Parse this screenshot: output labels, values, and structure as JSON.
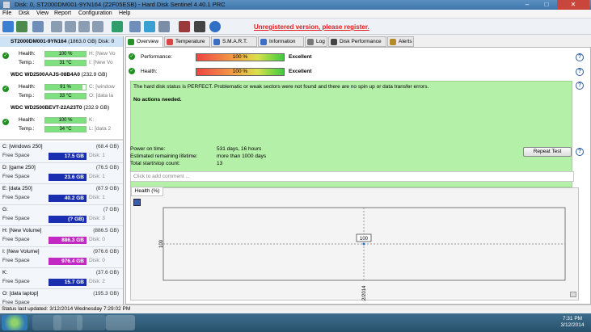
{
  "window": {
    "title": "Disk: 0, ST2000DM001-9YN164 (Z2F05ESB) - Hard Disk Sentinel 4.40.1 PRO",
    "min": "–",
    "max": "□",
    "close": "✕"
  },
  "menu": [
    "File",
    "Disk",
    "View",
    "Report",
    "Configuration",
    "Help"
  ],
  "unregistered": "Unregistered version, please register.",
  "tabs": [
    {
      "label": "Overview",
      "icon": "check-icon",
      "color": "#2a8f2a"
    },
    {
      "label": "Temperature",
      "icon": "thermometer-icon",
      "color": "#d44"
    },
    {
      "label": "S.M.A.R.T.",
      "icon": "smart-icon",
      "color": "#3a6fc4"
    },
    {
      "label": "Information",
      "icon": "info-icon",
      "color": "#3a6fc4"
    },
    {
      "label": "Log",
      "icon": "log-icon",
      "color": "#777"
    },
    {
      "label": "Disk Performance",
      "icon": "performance-icon",
      "color": "#444"
    },
    {
      "label": "Alerts",
      "icon": "alert-icon",
      "color": "#b58a2a"
    }
  ],
  "disks": [
    {
      "name": "ST2000DM001-9YN164",
      "cap": "(1863.0 GB)",
      "disk": "Disk: 0",
      "health": "100 %",
      "health_pct": 100,
      "health_extra": "H: [New Vo",
      "temp": "31 °C",
      "temp_pct": 31,
      "temp_extra": "I: [New Vo",
      "selected": true
    },
    {
      "name": "WDC WD2500AAJS-08B4A0",
      "cap": "(232.9 GB)",
      "disk": "",
      "health": "91 %",
      "health_pct": 91,
      "health_extra": "C: [window",
      "temp": "33 °C",
      "temp_pct": 33,
      "temp_extra": "O: [data la",
      "selected": false
    },
    {
      "name": "WDC WD2500BEVT-22A23T0",
      "cap": "(232.9 GB)",
      "disk": "",
      "health": "100 %",
      "health_pct": 100,
      "health_extra": "K:",
      "temp": "34 °C",
      "temp_pct": 34,
      "temp_extra": "L: [data 2",
      "selected": false
    }
  ],
  "labels": {
    "health": "Health:",
    "temp": "Temp.:",
    "free_space": "Free Space"
  },
  "volumes": [
    {
      "name": "C: [windows 250]",
      "cap": "(68.4 GB)",
      "free": "17.5 GB",
      "color": "#1a2fb0",
      "disk": "Disk: 1"
    },
    {
      "name": "D: [game 250]",
      "cap": "(76.5 GB)",
      "free": "23.6 GB",
      "color": "#1a2fb0",
      "disk": "Disk: 1"
    },
    {
      "name": "E: [data 250]",
      "cap": "(87.9 GB)",
      "free": "40.2 GB",
      "color": "#1a2fb0",
      "disk": "Disk: 1"
    },
    {
      "name": "G:",
      "cap": "(7 GB)",
      "free": "(? GB)",
      "color": "#1a2fb0",
      "disk": "Disk: 3"
    },
    {
      "name": "H: [New Volume]",
      "cap": "(886.5 GB)",
      "free": "886.3 GB",
      "color": "#c229c2",
      "disk": "Disk: 0"
    },
    {
      "name": "I: [New Volume]",
      "cap": "(976.6 GB)",
      "free": "976.4 GB",
      "color": "#c229c2",
      "disk": "Disk: 0"
    },
    {
      "name": "K:",
      "cap": "(37.6 GB)",
      "free": "15.7 GB",
      "color": "#1a2fb0",
      "disk": "Disk: 2"
    },
    {
      "name": "O: [data laptop]",
      "cap": "(195.3 GB)",
      "free": "",
      "color": "#1a2fb0",
      "disk": ""
    }
  ],
  "overview": {
    "performance_label": "Performance:",
    "performance_value": "100 %",
    "performance_status": "Excellent",
    "health_label": "Health:",
    "health_value": "100 %",
    "health_status": "Excellent",
    "message": "The hard disk status is PERFECT. Problematic or weak sectors were not found and there are no spin up or data transfer errors.",
    "actions": "No actions needed.",
    "power_on_label": "Power on time:",
    "power_on_value": "531 days, 16 hours",
    "remaining_label": "Estimated remaining lifetime:",
    "remaining_value": "more than 1000 days",
    "startstop_label": "Total start/stop count:",
    "startstop_value": "13",
    "repeat_button": "Repeat Test",
    "comment_placeholder": "Click to add comment ..."
  },
  "chart_data": {
    "type": "line",
    "tab": "Health (%)",
    "x": [
      "3/12/2014"
    ],
    "values": [
      100
    ],
    "ylabel": "100",
    "point_label": "100"
  },
  "status": "Status last updated: 3/12/2014 Wednesday 7:29:02 PM",
  "clock": {
    "time": "7:31 PM",
    "date": "3/12/2014"
  }
}
